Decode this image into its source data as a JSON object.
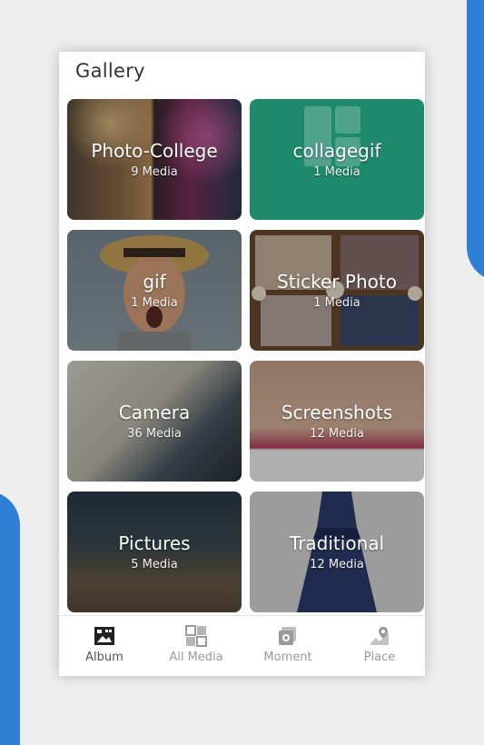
{
  "header": {
    "title": "Gallery"
  },
  "albums": [
    {
      "name": "Photo-College",
      "count": "9 Media"
    },
    {
      "name": "collagegif",
      "count": "1 Media"
    },
    {
      "name": "gif",
      "count": "1 Media"
    },
    {
      "name": "Sticker Photo",
      "count": "1 Media"
    },
    {
      "name": "Camera",
      "count": "36 Media"
    },
    {
      "name": "Screenshots",
      "count": "12 Media"
    },
    {
      "name": "Pictures",
      "count": "5 Media"
    },
    {
      "name": "Traditional",
      "count": "12 Media"
    }
  ],
  "bottom_nav": {
    "items": [
      {
        "label": "Album",
        "icon": "album-icon",
        "active": true
      },
      {
        "label": "All Media",
        "icon": "all-media-icon",
        "active": false
      },
      {
        "label": "Moment",
        "icon": "moment-icon",
        "active": false
      },
      {
        "label": "Place",
        "icon": "place-icon",
        "active": false
      }
    ]
  },
  "colors": {
    "accent_blue": "#2f7fd6",
    "collagegif_tile": "#1f8a6b"
  }
}
